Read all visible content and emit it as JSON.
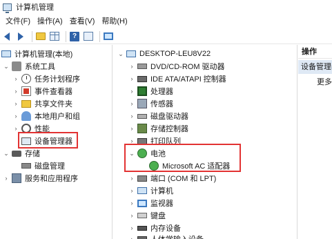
{
  "window": {
    "title": "计算机管理"
  },
  "menu": [
    "文件(F)",
    "操作(A)",
    "查看(V)",
    "帮助(H)"
  ],
  "toolbar": {
    "back_icon": "arrow-left-icon",
    "forward_icon": "arrow-right-icon"
  },
  "left_tree": {
    "root": "计算机管理(本地)",
    "system_tools": "系统工具",
    "task_scheduler": "任务计划程序",
    "event_viewer": "事件查看器",
    "shared_folders": "共享文件夹",
    "local_users": "本地用户和组",
    "performance": "性能",
    "device_manager": "设备管理器",
    "storage": "存储",
    "disk_management": "磁盘管理",
    "services": "服务和应用程序"
  },
  "device_tree": {
    "computer": "DESKTOP-LEU8V22",
    "items": {
      "dvd": "DVD/CD-ROM 驱动器",
      "ide": "IDE ATA/ATAPI 控制器",
      "cpu": "处理器",
      "sensors": "传感器",
      "disk_drives": "磁盘驱动器",
      "storage_ctl": "存储控制器",
      "print_queue": "打印队列",
      "battery": "电池",
      "ac_adapter": "Microsoft AC 适配器",
      "ports": "端口 (COM 和 LPT)",
      "computer_cat": "计算机",
      "monitors": "监视器",
      "keyboards": "键盘",
      "memory": "内存设备",
      "hid": "人体学输入设备"
    }
  },
  "actions": {
    "header": "操作",
    "selected": "设备管理器",
    "more": "更多"
  },
  "colors": {
    "highlight_box": "#e23232",
    "selection": "#dfe9f5"
  }
}
